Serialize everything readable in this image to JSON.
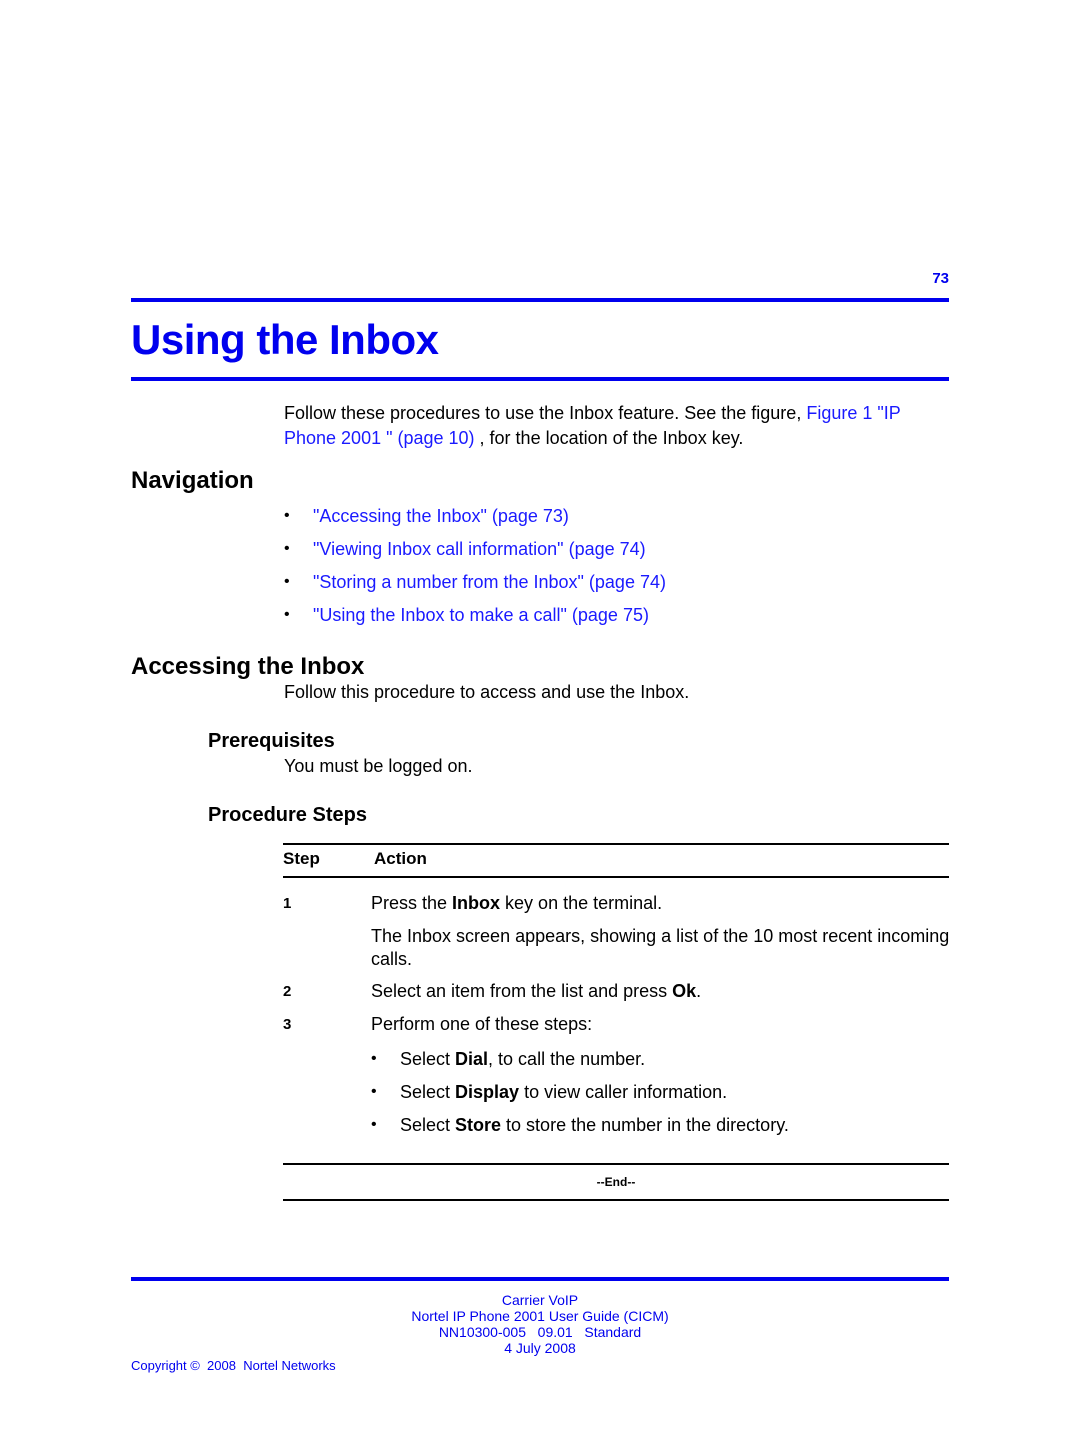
{
  "header": {
    "page_number": "73",
    "title": "Using the Inbox"
  },
  "intro": {
    "text_before": "Follow these procedures to use the Inbox feature. See the figure, ",
    "link_text": "Figure 1 \"IP Phone 2001 \" (page 10)",
    "text_after": " , for the location of the Inbox key."
  },
  "navigation": {
    "heading": "Navigation",
    "items": [
      {
        "label": "\"Accessing the Inbox\" (page 73)"
      },
      {
        "label": "\"Viewing Inbox call information\" (page 74)"
      },
      {
        "label": "\"Storing a number from the Inbox\" (page 74)"
      },
      {
        "label": "\"Using the Inbox to make a call\" (page 75)"
      }
    ]
  },
  "accessing": {
    "heading": "Accessing the Inbox",
    "description": "Follow this procedure to access and use the Inbox.",
    "prerequisites": {
      "heading": "Prerequisites",
      "text": "You must be logged on."
    },
    "procedure": {
      "heading": "Procedure Steps",
      "columns": [
        "Step",
        "Action"
      ],
      "steps": [
        {
          "number": "1",
          "pre": "Press the ",
          "bold": "Inbox",
          "post": " key on the terminal.",
          "note": "The Inbox screen appears, showing a list of the 10 most recent incoming calls."
        },
        {
          "number": "2",
          "pre": "Select an item from the list and press ",
          "bold": "Ok",
          "post": "."
        },
        {
          "number": "3",
          "text": "Perform one of these steps:",
          "substeps": [
            {
              "pre": "Select ",
              "bold": "Dial",
              "post": ", to call the number."
            },
            {
              "pre": "Select ",
              "bold": "Display",
              "post": " to view caller information."
            },
            {
              "pre": "Select ",
              "bold": "Store",
              "post": " to store the number in the directory."
            }
          ]
        }
      ],
      "end_marker": "--End--"
    }
  },
  "footer": {
    "line1": "Carrier VoIP",
    "line2": "Nortel IP Phone 2001 User Guide (CICM)",
    "line3": "NN10300-005   09.01   Standard",
    "line4": "4 July 2008",
    "copyright": "Copyright ©  2008  Nortel Networks"
  }
}
